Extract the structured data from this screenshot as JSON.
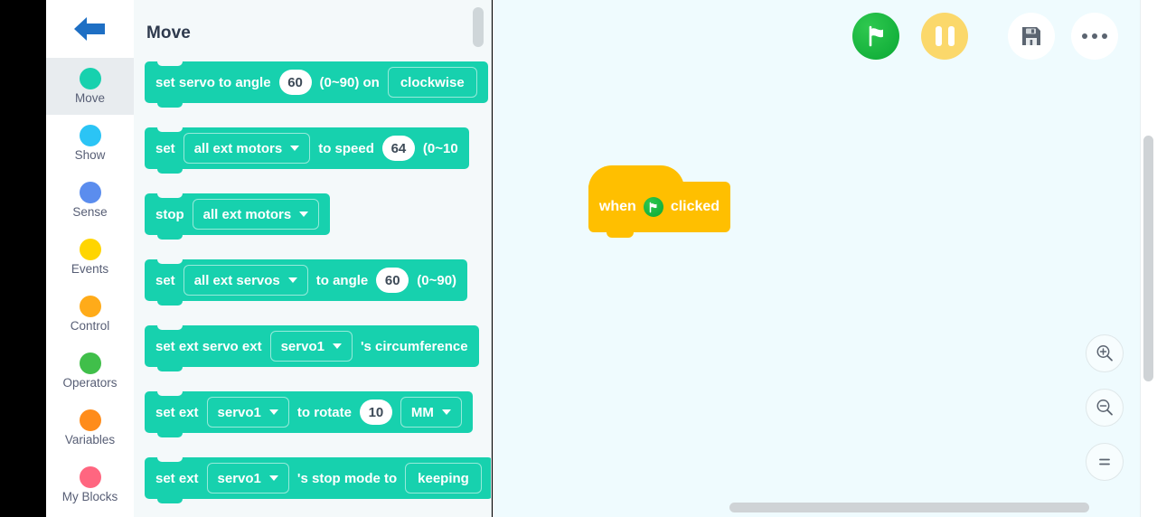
{
  "app": {
    "back_icon": "back-arrow-icon"
  },
  "sidebar": {
    "items": [
      {
        "label": "Move",
        "color": "#17d1ae",
        "active": true
      },
      {
        "label": "Show",
        "color": "#2bc4f5",
        "active": false
      },
      {
        "label": "Sense",
        "color": "#5b8dee",
        "active": false
      },
      {
        "label": "Events",
        "color": "#ffd500",
        "active": false
      },
      {
        "label": "Control",
        "color": "#ffab19",
        "active": false
      },
      {
        "label": "Operators",
        "color": "#40bf4a",
        "active": false
      },
      {
        "label": "Variables",
        "color": "#ff8c1a",
        "active": false
      },
      {
        "label": "My Blocks",
        "color": "#ff6680",
        "active": false
      }
    ]
  },
  "palette": {
    "title": "Move",
    "block_color": "#17d1ae",
    "blocks": [
      {
        "name": "set-servo-to-angle",
        "parts": [
          {
            "type": "text",
            "value": "set servo to angle"
          },
          {
            "type": "number",
            "value": "60"
          },
          {
            "type": "text",
            "value": "(0~90) on"
          },
          {
            "type": "dropdown_plain",
            "value": "clockwise"
          }
        ]
      },
      {
        "name": "set-motor-speed",
        "parts": [
          {
            "type": "text",
            "value": "set"
          },
          {
            "type": "dropdown",
            "value": "all ext motors"
          },
          {
            "type": "text",
            "value": "to speed"
          },
          {
            "type": "number",
            "value": "64"
          },
          {
            "type": "text",
            "value": "(0~10"
          }
        ]
      },
      {
        "name": "stop-motors",
        "parts": [
          {
            "type": "text",
            "value": "stop"
          },
          {
            "type": "dropdown",
            "value": "all ext motors"
          }
        ]
      },
      {
        "name": "set-servos-angle",
        "parts": [
          {
            "type": "text",
            "value": "set"
          },
          {
            "type": "dropdown",
            "value": "all ext servos"
          },
          {
            "type": "text",
            "value": "to angle"
          },
          {
            "type": "number",
            "value": "60"
          },
          {
            "type": "text",
            "value": "(0~90)"
          }
        ]
      },
      {
        "name": "set-servo-circumference",
        "parts": [
          {
            "type": "text",
            "value": "set ext servo  ext"
          },
          {
            "type": "dropdown",
            "value": "servo1"
          },
          {
            "type": "text",
            "value": "'s circumference"
          }
        ]
      },
      {
        "name": "set-servo-rotate",
        "parts": [
          {
            "type": "text",
            "value": "set  ext"
          },
          {
            "type": "dropdown",
            "value": "servo1"
          },
          {
            "type": "text",
            "value": "to rotate"
          },
          {
            "type": "number",
            "value": "10"
          },
          {
            "type": "dropdown",
            "value": "MM"
          }
        ]
      },
      {
        "name": "set-servo-stop-mode",
        "parts": [
          {
            "type": "text",
            "value": "set  ext"
          },
          {
            "type": "dropdown",
            "value": "servo1"
          },
          {
            "type": "text",
            "value": "'s stop mode to"
          },
          {
            "type": "dropdown_plain",
            "value": "keeping"
          }
        ]
      }
    ]
  },
  "toolbar": {
    "go_label": "green-flag",
    "pause_label": "pause",
    "save_label": "save",
    "more_label": "more-options"
  },
  "workspace": {
    "background": "#effbfe",
    "script": {
      "hat_color": "#ffbf00",
      "prefix": "when",
      "suffix": "clicked"
    }
  },
  "zoom_controls": {
    "zoom_in": "zoom-in",
    "zoom_out": "zoom-out",
    "zoom_reset": "zoom-reset"
  }
}
